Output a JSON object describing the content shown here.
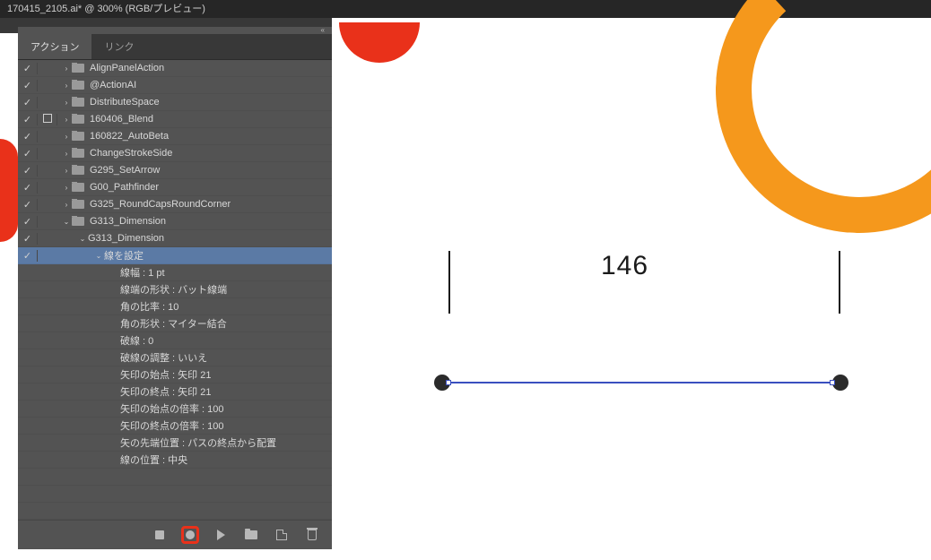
{
  "title_bar": "170415_2105.ai* @ 300% (RGB/プレビュー)",
  "tabs": {
    "actions": "アクション",
    "links": "リンク"
  },
  "collapse_glyph": "«",
  "action_sets": [
    {
      "check": true,
      "rec": "",
      "expand": ">",
      "folder": true,
      "label": "AlignPanelAction",
      "indent": 0
    },
    {
      "check": true,
      "rec": "",
      "expand": ">",
      "folder": true,
      "label": "@ActionAI",
      "indent": 0
    },
    {
      "check": true,
      "rec": "",
      "expand": ">",
      "folder": true,
      "label": "DistributeSpace",
      "indent": 0
    },
    {
      "check": true,
      "rec": "box",
      "expand": ">",
      "folder": true,
      "label": "160406_Blend",
      "indent": 0
    },
    {
      "check": true,
      "rec": "",
      "expand": ">",
      "folder": true,
      "label": "160822_AutoBeta",
      "indent": 0
    },
    {
      "check": true,
      "rec": "",
      "expand": ">",
      "folder": true,
      "label": "ChangeStrokeSide",
      "indent": 0
    },
    {
      "check": true,
      "rec": "",
      "expand": ">",
      "folder": true,
      "label": "G295_SetArrow",
      "indent": 0
    },
    {
      "check": true,
      "rec": "",
      "expand": ">",
      "folder": true,
      "label": "G00_Pathfinder",
      "indent": 0
    },
    {
      "check": true,
      "rec": "",
      "expand": ">",
      "folder": true,
      "label": "G325_RoundCapsRoundCorner",
      "indent": 0
    },
    {
      "check": true,
      "rec": "",
      "expand": "v",
      "folder": true,
      "label": "G313_Dimension",
      "indent": 0
    },
    {
      "check": true,
      "rec": "",
      "expand": "v",
      "folder": false,
      "label": "G313_Dimension",
      "indent": 1
    },
    {
      "check": true,
      "rec": "",
      "expand": "v",
      "folder": false,
      "label": "線を設定",
      "indent": 2,
      "selected": true
    },
    {
      "check": false,
      "rec": "",
      "expand": "",
      "folder": false,
      "label": "線幅 : 1 pt",
      "indent": 3
    },
    {
      "check": false,
      "rec": "",
      "expand": "",
      "folder": false,
      "label": "線端の形状 : バット線端",
      "indent": 3
    },
    {
      "check": false,
      "rec": "",
      "expand": "",
      "folder": false,
      "label": "角の比率 : 10",
      "indent": 3
    },
    {
      "check": false,
      "rec": "",
      "expand": "",
      "folder": false,
      "label": "角の形状 : マイター結合",
      "indent": 3
    },
    {
      "check": false,
      "rec": "",
      "expand": "",
      "folder": false,
      "label": "破線 : 0",
      "indent": 3
    },
    {
      "check": false,
      "rec": "",
      "expand": "",
      "folder": false,
      "label": "破線の調整 : いいえ",
      "indent": 3
    },
    {
      "check": false,
      "rec": "",
      "expand": "",
      "folder": false,
      "label": "矢印の始点 : 矢印 21",
      "indent": 3
    },
    {
      "check": false,
      "rec": "",
      "expand": "",
      "folder": false,
      "label": "矢印の終点 : 矢印 21",
      "indent": 3
    },
    {
      "check": false,
      "rec": "",
      "expand": "",
      "folder": false,
      "label": "矢印の始点の倍率 : 100",
      "indent": 3
    },
    {
      "check": false,
      "rec": "",
      "expand": "",
      "folder": false,
      "label": "矢印の終点の倍率 : 100",
      "indent": 3
    },
    {
      "check": false,
      "rec": "",
      "expand": "",
      "folder": false,
      "label": "矢の先端位置 : パスの終点から配置",
      "indent": 3
    },
    {
      "check": false,
      "rec": "",
      "expand": "",
      "folder": false,
      "label": "線の位置 : 中央",
      "indent": 3
    }
  ],
  "canvas": {
    "dimension_value": "146"
  },
  "footer": {
    "stop": "stop",
    "record": "record",
    "play": "play",
    "new_set": "new-set",
    "new_action": "new-action",
    "delete": "delete"
  }
}
